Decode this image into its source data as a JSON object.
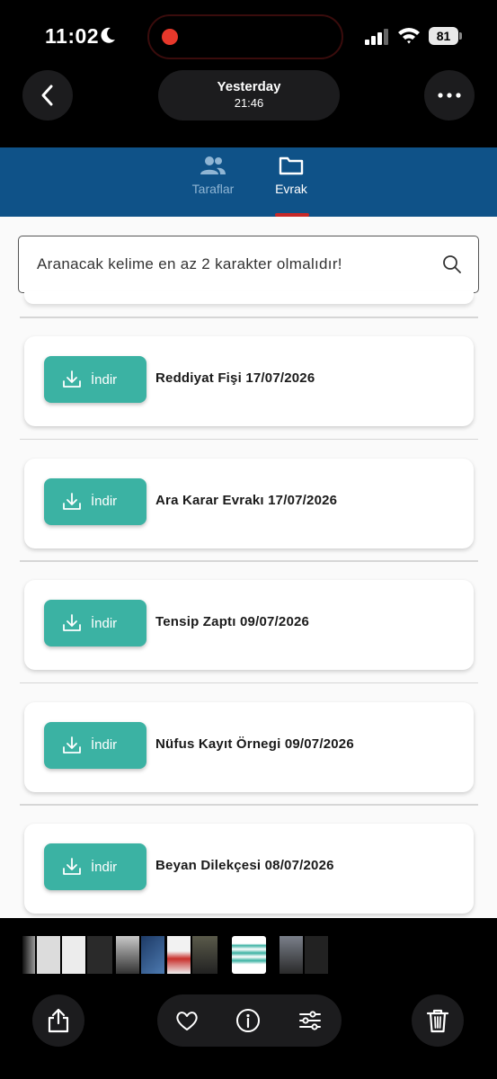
{
  "status_bar": {
    "time": "11:02",
    "battery": "81"
  },
  "top_bar": {
    "date_line": "Yesterday",
    "time_line": "21:46"
  },
  "tabs": [
    {
      "label": "Taraflar",
      "icon": "people-icon",
      "active": false
    },
    {
      "label": "Evrak",
      "icon": "folder-icon",
      "active": true
    }
  ],
  "search": {
    "placeholder": "Aranacak kelime en az 2 karakter olmalıdır!"
  },
  "documents": [
    {
      "button_label": "İndir",
      "title": "Reddiyat Fişi 17/07/2026"
    },
    {
      "button_label": "İndir",
      "title": "Ara Karar Evrakı 17/07/2026"
    },
    {
      "button_label": "İndir",
      "title": "Tensip Zaptı 09/07/2026"
    },
    {
      "button_label": "İndir",
      "title": "Nüfus Kayıt Örnegi 09/07/2026"
    },
    {
      "button_label": "İndir",
      "title": "Beyan Dilekçesi 08/07/2026"
    }
  ],
  "colors": {
    "header": "#0f5288",
    "download_button": "#3bb2a3",
    "tab_indicator": "#c62828",
    "recording_dot": "#e8382b"
  },
  "toolbar_icons": [
    "share-icon",
    "heart-icon",
    "info-icon",
    "adjust-icon",
    "trash-icon"
  ]
}
